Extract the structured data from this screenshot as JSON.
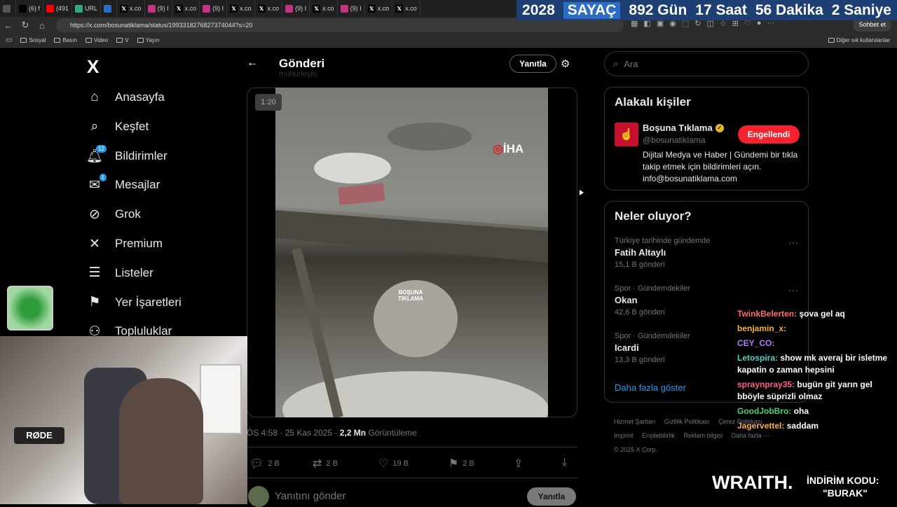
{
  "browser": {
    "tabs": [
      {
        "label": "",
        "color": "#555"
      },
      {
        "label": "(6) f",
        "color": "#000"
      },
      {
        "label": "(491",
        "color": "#ff0000"
      },
      {
        "label": "URL",
        "color": "#3a7"
      },
      {
        "label": "",
        "color": "#2b6cc4"
      },
      {
        "label": "x.co",
        "color": "#000"
      },
      {
        "label": "(9) I",
        "color": "#c13584"
      },
      {
        "label": "x.co",
        "color": "#000"
      },
      {
        "label": "(9) I",
        "color": "#c13584"
      },
      {
        "label": "x.co",
        "color": "#000"
      },
      {
        "label": "x.co",
        "color": "#000"
      },
      {
        "label": "(9) I",
        "color": "#c13584"
      },
      {
        "label": "x.co",
        "color": "#000"
      },
      {
        "label": "(9) I",
        "color": "#c13584"
      },
      {
        "label": "x.co",
        "color": "#000"
      },
      {
        "label": "x.co",
        "color": "#000"
      }
    ],
    "url": "https://x.com/bosunatiklama/status/1993318276827374044?s=20",
    "chat_button": "Sohbet et",
    "bookmarks": [
      "Sosyal",
      "Basın",
      "Video",
      "V",
      "Yayın"
    ],
    "other_bookmarks": "Diğer sık kullanılanlar"
  },
  "counter": {
    "year": "2028",
    "label": "SAYAÇ",
    "days": "892 Gün",
    "hours": "17 Saat",
    "minutes": "56 Dakika",
    "seconds": "2 Saniye"
  },
  "x_sidebar": {
    "logo": "X",
    "items": [
      {
        "label": "Anasayfa",
        "icon": "home-icon"
      },
      {
        "label": "Keşfet",
        "icon": "search-icon"
      },
      {
        "label": "Bildirimler",
        "icon": "bell-icon",
        "badge": "12"
      },
      {
        "label": "Mesajlar",
        "icon": "mail-icon",
        "badge": "1"
      },
      {
        "label": "Grok",
        "icon": "grok-icon"
      },
      {
        "label": "Premium",
        "icon": "x-icon"
      },
      {
        "label": "Listeler",
        "icon": "list-icon"
      },
      {
        "label": "Yer İşaretleri",
        "icon": "bookmark-icon"
      },
      {
        "label": "Topluluklar",
        "icon": "community-icon"
      }
    ]
  },
  "post": {
    "header_title": "Gönderi",
    "reply_button": "Yanıtla",
    "faded_text": "mühürleyin.",
    "video_timer": "1:20",
    "watermark": "İHA",
    "watermark2": "BOŞUNA TIKLAMA",
    "time": "ÖS 4:58",
    "date": "25 Kas 2025",
    "views": "2,2 Mn",
    "views_label": "Görüntüleme",
    "actions": {
      "replies": "2 B",
      "reposts": "2 B",
      "likes": "19 B",
      "bookmarks": "2 B"
    },
    "compose_placeholder": "Yanıtını gönder",
    "compose_button": "Yanıtla"
  },
  "right": {
    "search_placeholder": "Ara",
    "related_title": "Alakalı kişiler",
    "person": {
      "name": "Boşuna Tıklama",
      "handle": "@bosunatiklama",
      "bio": "Dijital Medya ve Haber | Gündemi bir tıkla takip etmek için bildirimleri açın. info@bosunatiklama.com",
      "button": "Engellendi"
    },
    "trends_title": "Neler oluyor?",
    "trends": [
      {
        "category": "Türkiye tarihinde gündemde",
        "name": "Fatih Altaylı",
        "count": "15,1 B gönderi"
      },
      {
        "category": "Spor · Gündemdekiler",
        "name": "Okan",
        "count": "42,6 B gönderi"
      },
      {
        "category": "Spor · Gündemdekiler",
        "name": "Icardi",
        "count": "13,3 B gönderi"
      }
    ],
    "show_more": "Daha fazla göster",
    "footer": [
      "Hizmet Şartları",
      "Gizlilik Politikası",
      "Çerez Politikası",
      "Imprint",
      "Erişilebilirlik",
      "Reklam bilgisi",
      "Daha fazla ···",
      "© 2025 X Corp."
    ]
  },
  "stream": {
    "mic_brand": "RØDE",
    "chat": [
      {
        "user": "TwinkBelerten:",
        "text": "şova gel aq",
        "color": "#ff6b6b"
      },
      {
        "user": "benjamin_x:",
        "text": "",
        "color": "#f0b429"
      },
      {
        "user": "CEY_CO:",
        "text": "",
        "color": "#b57bff"
      },
      {
        "user": "Letospira:",
        "text": "show mk averaj bir isletme kapatin o zaman hepsini",
        "color": "#4fd1c5"
      },
      {
        "user": "spraynpray35:",
        "text": "bugün git yarın gel bböyle süprizli olmaz",
        "color": "#ff5f7e"
      },
      {
        "user": "GoodJobBro:",
        "text": "oha",
        "color": "#48d26c"
      },
      {
        "user": "Jagervettel:",
        "text": "saddam",
        "color": "#f6ad55"
      }
    ],
    "sponsor": {
      "brand": "WRAITH.",
      "line1": "İNDİRİM KODU:",
      "line2": "\"BURAK\""
    }
  }
}
